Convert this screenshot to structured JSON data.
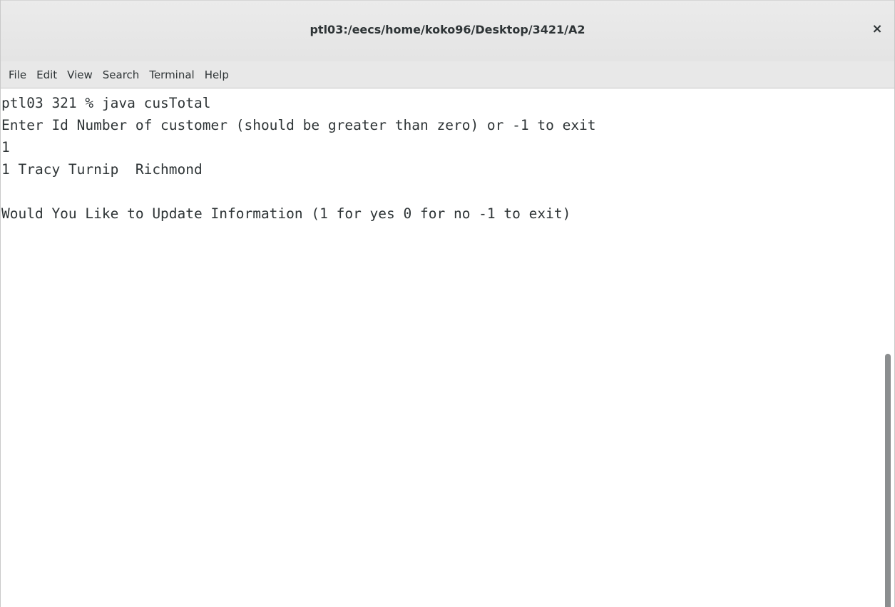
{
  "window": {
    "title": "ptl03:/eecs/home/koko96/Desktop/3421/A2",
    "close_symbol": "×",
    "close_icon": "close-icon"
  },
  "menubar": {
    "items": [
      "File",
      "Edit",
      "View",
      "Search",
      "Terminal",
      "Help"
    ]
  },
  "terminal": {
    "lines": [
      "ptl03 321 % java cusTotal",
      "Enter Id Number of customer (should be greater than zero) or -1 to exit",
      "1",
      "1 Tracy Turnip  Richmond",
      "",
      "Would You Like to Update Information (1 for yes 0 for no -1 to exit)"
    ]
  },
  "colors": {
    "background": "#ffffff",
    "text": "#2e3436",
    "titlebar": "#e8e8e8",
    "scroll_thumb": "#8b8e8f"
  }
}
